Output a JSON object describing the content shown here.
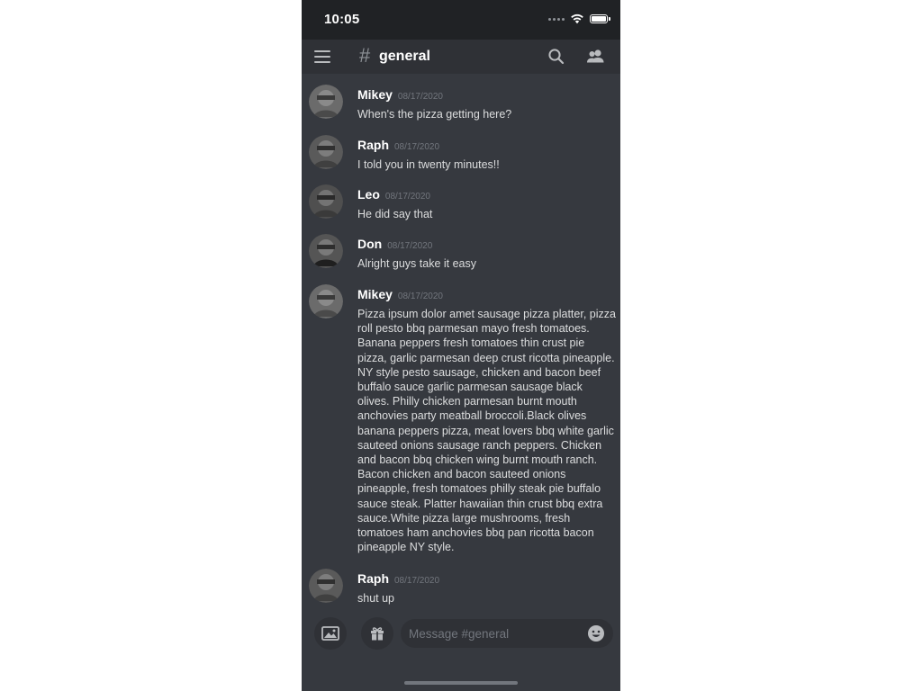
{
  "status_bar": {
    "time": "10:05",
    "icons": [
      "signal-icon",
      "wifi-icon",
      "battery-icon"
    ]
  },
  "header": {
    "hash": "#",
    "channel_name": "general",
    "icons": [
      "menu-icon",
      "search-icon",
      "members-icon"
    ]
  },
  "messages": [
    {
      "author": "Mikey",
      "timestamp": "08/17/2020",
      "text": "When's the pizza getting here?",
      "avatar_color": "#6b6b6b"
    },
    {
      "author": "Raph",
      "timestamp": "08/17/2020",
      "text": "I told you in twenty minutes!!",
      "avatar_color": "#5a5a5a"
    },
    {
      "author": "Leo",
      "timestamp": "08/17/2020",
      "text": "He did say that",
      "avatar_color": "#4f4f4f"
    },
    {
      "author": "Don",
      "timestamp": "08/17/2020",
      "text": "Alright guys take it easy",
      "avatar_color": "#555555"
    },
    {
      "author": "Mikey",
      "timestamp": "08/17/2020",
      "text": "Pizza ipsum dolor amet sausage pizza platter, pizza roll pesto bbq parmesan mayo fresh tomatoes. Banana peppers fresh tomatoes thin crust pie pizza, garlic parmesan deep crust ricotta pineapple. NY style pesto sausage, chicken and bacon beef buffalo sauce garlic parmesan sausage black olives. Philly chicken parmesan burnt mouth anchovies party meatball broccoli.Black olives banana peppers pizza, meat lovers bbq white garlic sauteed onions sausage ranch peppers. Chicken and bacon bbq chicken wing burnt mouth ranch. Bacon chicken and bacon sauteed onions pineapple, fresh tomatoes philly steak pie buffalo sauce steak. Platter hawaiian thin crust bbq extra sauce.White pizza large mushrooms, fresh tomatoes ham anchovies bbq pan ricotta bacon pineapple NY style.",
      "avatar_color": "#6b6b6b"
    },
    {
      "author": "Raph",
      "timestamp": "08/17/2020",
      "text": "shut up",
      "avatar_color": "#5a5a5a"
    }
  ],
  "composer": {
    "placeholder": "Message #general",
    "icons": [
      "image-icon",
      "gift-icon",
      "emoji-icon"
    ]
  },
  "colors": {
    "background": "#36393f",
    "header": "#2f3136",
    "status_bar": "#202225",
    "text": "#dcddde",
    "muted": "#72767d"
  }
}
